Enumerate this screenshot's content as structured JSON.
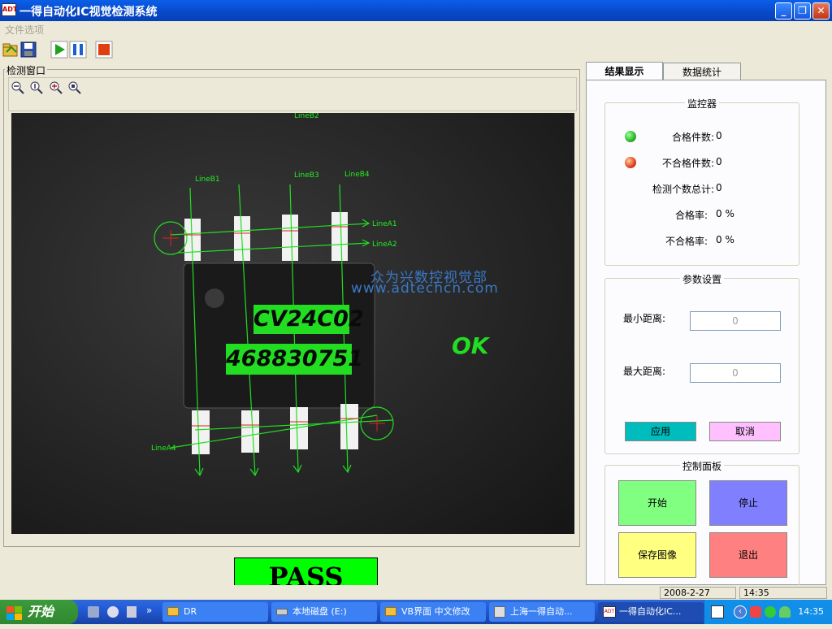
{
  "window": {
    "title": "一得自动化IC视觉检测系统",
    "app_icon": "adt-logo",
    "minimize": "minimize-icon",
    "maximize": "restore-icon",
    "close": "close-icon"
  },
  "menu": {
    "file_options": "文件选项"
  },
  "toolbar": {
    "icons": [
      "open-icon",
      "save-icon",
      "play-icon",
      "pause-icon",
      "stop-icon"
    ]
  },
  "detect_window": {
    "label": "检测窗口",
    "zoom_icons": [
      "zoom-out-icon",
      "zoom-info-icon",
      "zoom-in-icon",
      "zoom-reset-icon"
    ],
    "overlay": {
      "lines": [
        "LineA1",
        "LineA2",
        "LineB1",
        "LineB2",
        "LineB3",
        "LineB4",
        "LineA4"
      ],
      "watermark_cn": "众为兴数控视觉部",
      "watermark_url": "www.adtechcn.com",
      "ocr_line1": "CV24C02",
      "ocr_line2": "468830751",
      "status": "OK"
    }
  },
  "result": {
    "text": "PASS",
    "color": "#00FF00"
  },
  "tabs": [
    {
      "label": "结果显示",
      "active": true
    },
    {
      "label": "数据统计",
      "active": false
    }
  ],
  "monitor": {
    "title": "监控器",
    "pass_label": "合格件数:",
    "pass_value": "0",
    "pass_color": "#2DB52D",
    "fail_label": "不合格件数:",
    "fail_value": "0",
    "fail_color": "#E04020",
    "total_label": "检测个数总计:",
    "total_value": "0",
    "pass_rate_label": "合格率:",
    "pass_rate_value": "0 %",
    "fail_rate_label": "不合格率:",
    "fail_rate_value": "0 %"
  },
  "params": {
    "title": "参数设置",
    "min_label": "最小距离:",
    "min_value": "0",
    "max_label": "最大距离:",
    "max_value": "0",
    "apply": "应用",
    "cancel": "取消",
    "apply_color": "#00BDBD",
    "cancel_color": "#FFC0FF"
  },
  "control": {
    "title": "控制面板",
    "start": "开始",
    "stop": "停止",
    "save_image": "保存图像",
    "exit": "退出",
    "start_color": "#80FF80",
    "stop_color": "#8080FF",
    "save_color": "#FFFF80",
    "exit_color": "#FF8080"
  },
  "statusbar": {
    "date": "2008-2-27",
    "time": "14:35"
  },
  "taskbar": {
    "start": "开始",
    "tasks": [
      {
        "label": "DR",
        "icon": "folder-icon"
      },
      {
        "label": "本地磁盘 (E:)",
        "icon": "drive-icon"
      },
      {
        "label": "VB界面 中文修改",
        "icon": "folder-icon"
      },
      {
        "label": "上海一得自动...",
        "icon": "app-icon"
      },
      {
        "label": "一得自动化IC...",
        "icon": "adt-icon",
        "active": true
      }
    ],
    "clock": "14:35"
  }
}
